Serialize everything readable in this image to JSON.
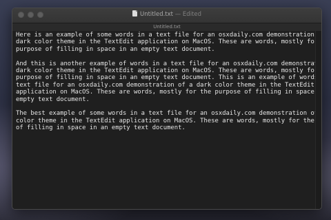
{
  "window": {
    "title": "Untitled.txt",
    "title_separator": "—",
    "status": "Edited",
    "tab_label": "Untitled.txt"
  },
  "document": {
    "lines": [
      "Here is an example of some words in a text file for an osxdaily.com demonstration of a",
      "dark color theme in the TextEdit application on MacOS. These are words, mostly for the",
      "purpose of filling in space in an empty text document.",
      "",
      "And this is another example of words in a text file for an osxdaily.com demonstration of a",
      "dark color theme in the TextEdit application on MacOS. These are words, mostly for the",
      "purpose of filling in space in an empty text document. This is an example of words in a",
      "text file for an osxdaily.com demonstration of a dark color theme in the TextEdit",
      "application on MacOS. These are words, mostly for the purpose of filling in space in an",
      "empty text document.",
      "",
      "The best example of some words in a text file for an osxdaily.com demonstration of a dark",
      "color theme in the TextEdit application on MacOS. These are words, mostly for the purpose",
      "of filling in space in an empty text document."
    ]
  },
  "colors": {
    "editor_background": "#1f1f1f",
    "text": "#e6e6e6",
    "titlebar": "#3d3d3d"
  }
}
